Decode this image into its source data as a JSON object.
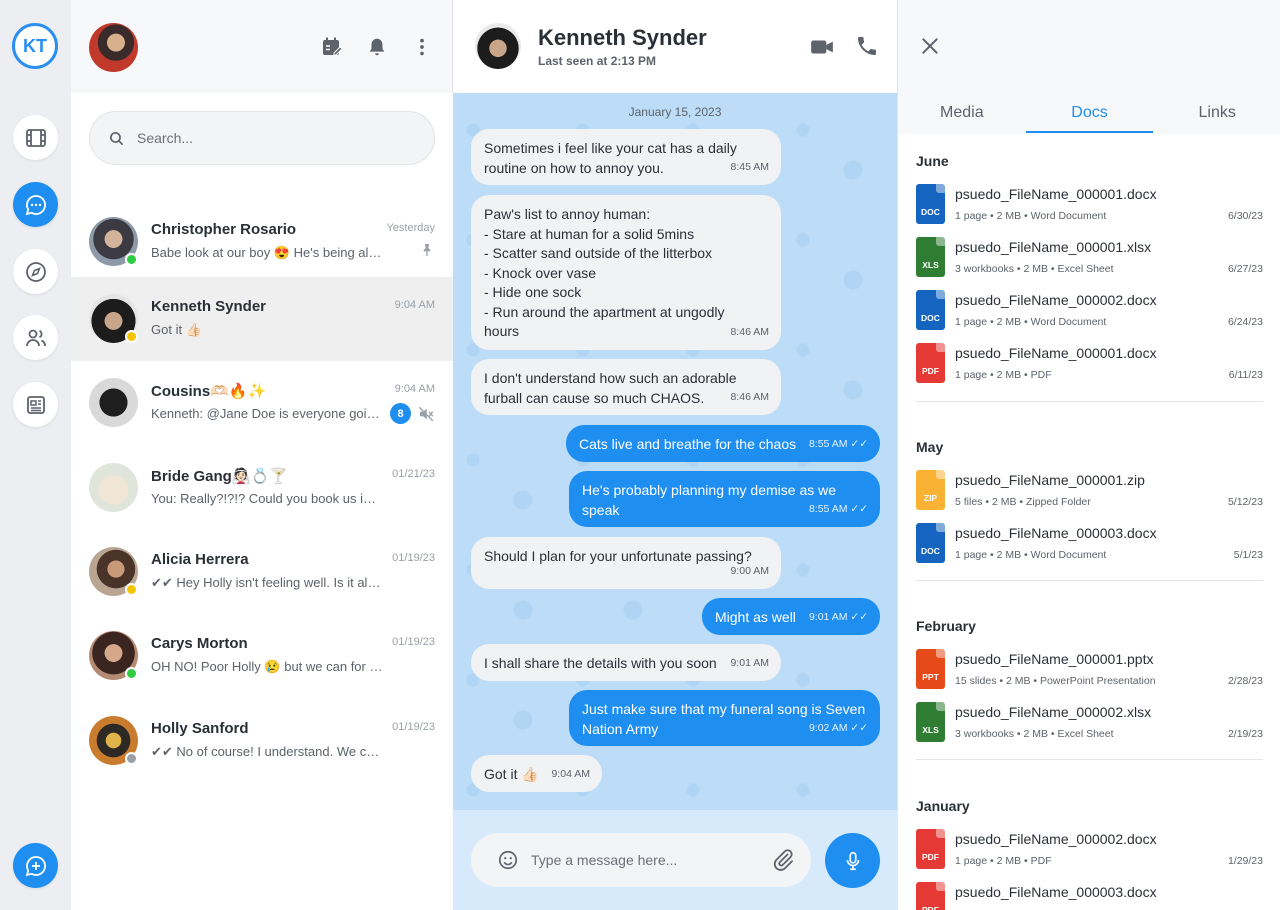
{
  "rail": {
    "logo": "KT"
  },
  "list": {
    "search_placeholder": "Search...",
    "chats": [
      {
        "name": "Christopher Rosario",
        "preview": "Babe look at our boy 😍 He's being all c...",
        "time": "Yesterday",
        "status": "online",
        "pinned": true
      },
      {
        "name": "Kenneth Synder",
        "preview": "Got it 👍🏻",
        "time": "9:04 AM",
        "status": "away",
        "active": true
      },
      {
        "name": "Cousins🫶🏻🔥✨",
        "preview": "Kenneth: @Jane Doe is everyone going...",
        "time": "9:04 AM",
        "badge": "8",
        "muted": true
      },
      {
        "name": "Bride Gang👰🏻💍🍸",
        "preview": "You: Really?!?!? Could you book us in fo...",
        "time": "01/21/23"
      },
      {
        "name": "Alicia Herrera",
        "preview": "✔✔ Hey Holly isn't feeling well. Is it alrig...",
        "time": "01/19/23",
        "status": "away"
      },
      {
        "name": "Carys Morton",
        "preview": "OH NO! Poor Holly 😢 but we can for s...",
        "time": "01/19/23",
        "status": "online"
      },
      {
        "name": "Holly Sanford",
        "preview": "✔✔ No of course! I understand. We can r...",
        "time": "01/19/23",
        "status": "idle"
      }
    ]
  },
  "conversation": {
    "title": "Kenneth Synder",
    "last_seen": "Last seen at 2:13 PM",
    "date": "January 15, 2023",
    "messages": [
      {
        "dir": "in",
        "text": "Sometimes i feel like your cat has a daily\nroutine on how to annoy you.",
        "time": "8:45 AM"
      },
      {
        "dir": "in",
        "text": "Paw's list to annoy human:\n - Stare at human for a solid 5mins\n - Scatter sand outside of the litterbox\n - Knock over vase\n - Hide one sock\n - Run around the apartment at ungodly\nhours",
        "time": "8:46 AM"
      },
      {
        "dir": "in",
        "text": "I don't understand how such an adorable\nfurball can cause so much CHAOS.",
        "time": "8:46 AM"
      },
      {
        "dir": "out",
        "text": "Cats live and breathe for the chaos",
        "time": "8:55 AM ✓✓"
      },
      {
        "dir": "out",
        "text": "He's probably planning my demise as we\nspeak",
        "time": "8:55 AM ✓✓"
      },
      {
        "dir": "in",
        "text": "Should I plan for your unfortunate passing?",
        "time": "9:00 AM"
      },
      {
        "dir": "out",
        "text": "Might as well",
        "time": "9:01 AM ✓✓"
      },
      {
        "dir": "in",
        "text": "I shall share the details with you soon",
        "time": "9:01 AM"
      },
      {
        "dir": "out",
        "text": "Just make sure that my funeral song is Seven\nNation Army",
        "time": "9:02 AM ✓✓"
      },
      {
        "dir": "in",
        "text": "Got it 👍🏻",
        "time": "9:04 AM"
      }
    ],
    "composer_placeholder": "Type a message here..."
  },
  "panel": {
    "tabs": [
      "Media",
      "Docs",
      "Links"
    ],
    "active_tab": "Docs",
    "sections": [
      {
        "title": "June",
        "docs": [
          {
            "name": "psuedo_FileName_000001.docx",
            "info": "1 page • 2 MB • Word Document",
            "date": "6/30/23",
            "type": "DOC",
            "color": "#1565c0"
          },
          {
            "name": "psuedo_FileName_000001.xlsx",
            "info": "3 workbooks • 2 MB • Excel Sheet",
            "date": "6/27/23",
            "type": "XLS",
            "color": "#2e7d32"
          },
          {
            "name": "psuedo_FileName_000002.docx",
            "info": "1 page • 2 MB • Word Document",
            "date": "6/24/23",
            "type": "DOC",
            "color": "#1565c0"
          },
          {
            "name": "psuedo_FileName_000001.docx",
            "info": "1 page • 2 MB • PDF",
            "date": "6/11/23",
            "type": "PDF",
            "color": "#e53935"
          }
        ]
      },
      {
        "title": "May",
        "docs": [
          {
            "name": "psuedo_FileName_000001.zip",
            "info": "5 files • 2 MB • Zipped Folder",
            "date": "5/12/23",
            "type": "ZIP",
            "color": "#f9b233"
          },
          {
            "name": "psuedo_FileName_000003.docx",
            "info": "1 page • 2 MB • Word Document",
            "date": "5/1/23",
            "type": "DOC",
            "color": "#1565c0"
          }
        ]
      },
      {
        "title": "February",
        "docs": [
          {
            "name": "psuedo_FileName_000001.pptx",
            "info": "15 slides • 2 MB • PowerPoint Presentation",
            "date": "2/28/23",
            "type": "PPT",
            "color": "#e64a19"
          },
          {
            "name": "psuedo_FileName_000002.xlsx",
            "info": "3 workbooks • 2 MB • Excel Sheet",
            "date": "2/19/23",
            "type": "XLS",
            "color": "#2e7d32"
          }
        ]
      },
      {
        "title": "January",
        "docs": [
          {
            "name": "psuedo_FileName_000002.docx",
            "info": "1 page • 2 MB • PDF",
            "date": "1/29/23",
            "type": "PDF",
            "color": "#e53935"
          },
          {
            "name": "psuedo_FileName_000003.docx",
            "info": "",
            "date": "",
            "type": "PDF",
            "color": "#e53935"
          }
        ]
      }
    ]
  },
  "colors": {
    "accent": "#1e8ef0",
    "online": "#2ecc40",
    "away": "#f5c400"
  }
}
